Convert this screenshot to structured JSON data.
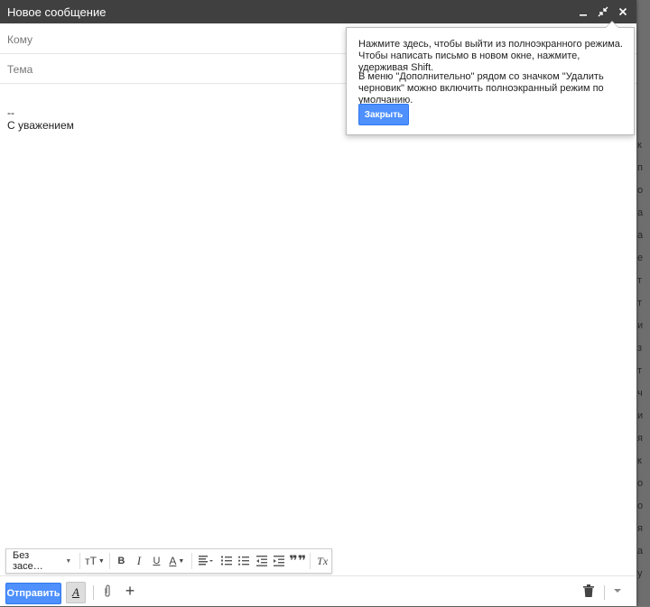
{
  "window": {
    "title": "Новое сообщение"
  },
  "fields": {
    "to_placeholder": "Кому",
    "subject_placeholder": "Тема"
  },
  "body": {
    "sig_sep": "--",
    "sig_text": "С уважением"
  },
  "format_toolbar": {
    "font_name": "Без засе…",
    "icons": [
      "font-size-icon",
      "bold-icon",
      "italic-icon",
      "underline-icon",
      "text-color-icon",
      "align-icon",
      "numbered-list-icon",
      "bulleted-list-icon",
      "indent-less-icon",
      "indent-more-icon",
      "quote-icon",
      "remove-formatting-icon"
    ],
    "bold": "B",
    "italic": "I",
    "underline": "U",
    "text_color": "A",
    "font_size": "тT",
    "clear_format": "Tx"
  },
  "actions": {
    "send_label": "Отправить",
    "format_toggle": "A"
  },
  "tooltip": {
    "line1": "Нажмите здесь, чтобы выйти из полноэкранного режима. Чтобы написать письмо в новом окне, нажмите, удерживая Shift.",
    "line2": "В меню \"Дополнительно\" рядом со значком \"Удалить черновик\" можно включить полноэкранный режим по умолчанию.",
    "close_label": "Закрыть"
  },
  "background_strip": [
    "к",
    "п",
    "о",
    "а",
    "а",
    "е",
    "т",
    "т",
    "и",
    "з",
    "т",
    "ч",
    "и",
    "я",
    "к",
    "о",
    "о",
    "я",
    "а",
    "у"
  ],
  "colors": {
    "titlebar": "#404040",
    "accent": "#4d90fe"
  }
}
